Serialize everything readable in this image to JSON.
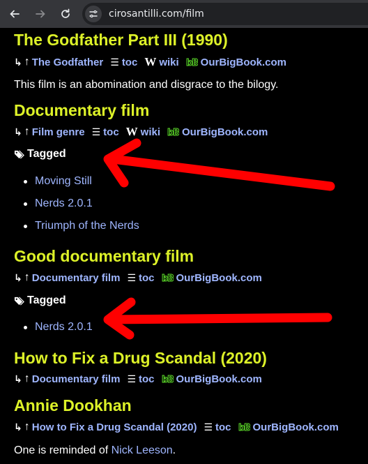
{
  "browser": {
    "url": "cirosantilli.com/film"
  },
  "sections": [
    {
      "title": "The Godfather Part III (1990)",
      "parent": "The Godfather",
      "toc": "toc",
      "wiki": "wiki",
      "obb": "OurBigBook.com",
      "text": "This film is an abomination and disgrace to the bilogy."
    },
    {
      "title": "Documentary film",
      "parent": "Film genre",
      "toc": "toc",
      "wiki": "wiki",
      "obb": "OurBigBook.com",
      "tagged_label": "Tagged",
      "tags": [
        "Moving Still",
        "Nerds 2.0.1",
        "Triumph of the Nerds"
      ]
    },
    {
      "title": "Good documentary film",
      "parent": "Documentary film",
      "toc": "toc",
      "obb": "OurBigBook.com",
      "tagged_label": "Tagged",
      "tags": [
        "Nerds 2.0.1"
      ]
    },
    {
      "title": "How to Fix a Drug Scandal (2020)",
      "parent": "Documentary film",
      "toc": "toc",
      "obb": "OurBigBook.com"
    },
    {
      "title": "Annie Dookhan",
      "parent": "How to Fix a Drug Scandal (2020)",
      "toc": "toc",
      "obb": "OurBigBook.com",
      "text_prefix": "One is reminded of ",
      "text_link": "Nick Leeson",
      "text_suffix": "."
    }
  ],
  "colors": {
    "heading": "#ddf228",
    "link": "#9fb6ff",
    "annotation_arrow": "#ff0000"
  }
}
